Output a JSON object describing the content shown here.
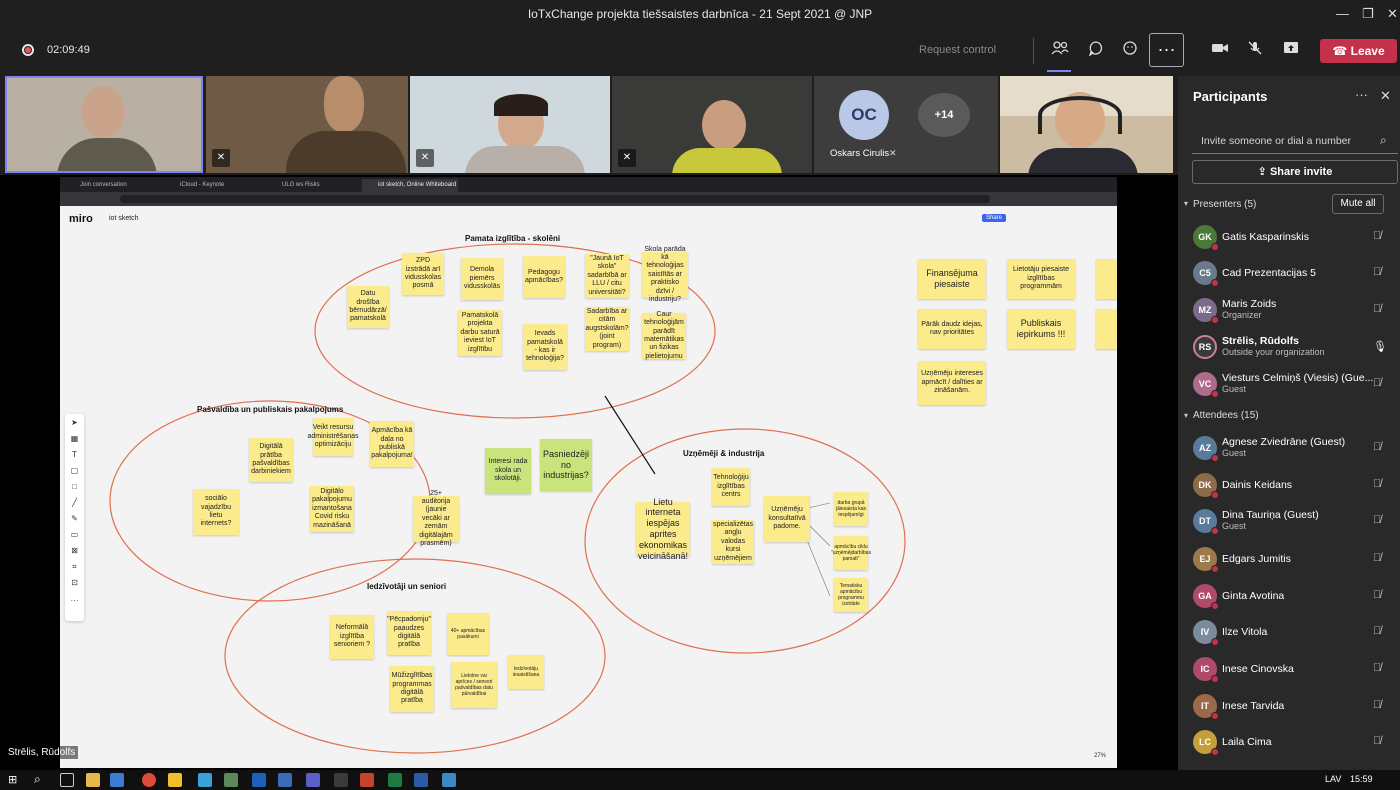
{
  "window": {
    "title": "IoTxChange projekta tiešsaistes darbnīca - 21 Sept 2021 @ JNP"
  },
  "toolbar": {
    "timer": "02:09:49",
    "request_control": "Request control",
    "leave_label": "Leave"
  },
  "videos": {
    "initials": "OC",
    "name": "Oskars Cirulis",
    "overflow": "+14",
    "speaker_label": "Strēlis, Rūdolfs"
  },
  "browser": {
    "tabs": [
      "Join conversation",
      "iCloud - Keynote",
      "ULG ws Risks",
      "iot sketch, Online Whiteboard f..."
    ],
    "app_name": "miro",
    "board_name": "iot sketch",
    "share_label": "Share",
    "zoom": "27%"
  },
  "board": {
    "frames": {
      "school": "Pamata izglītība - skolēni",
      "municipal": "Pašvaldība un publiskais pakalpojums",
      "business": "Uzņēmēji & industrija",
      "seniors": "Iedzīvotāji un seniori"
    },
    "stickies": {
      "s1": "Datu drošība bērnudārzā/ pamatskolā",
      "s2": "ZPD izstrādā arī vidusskolas posmā",
      "s3": "Demola piemērs vidusskolās",
      "s4": "Pamatskolā projekta darbu saturā ieviest IoT izglītību",
      "s5": "Pedagogu apmācības?",
      "s6": "Ievads pamatskolā - kas ir tehnoloģija?",
      "s7": "\"Jaunā IoT skola\" sadarbībā ar LLU / citu universitāti?",
      "s8": "Sadarbība ar citām augstskolām? (joint program)",
      "s9": "Skola parāda kā tehnoloģijas saistītās ar praktisko dzīvi / industriju?",
      "s10": "Caur tehnoloģijām parādīt matemātikas un fizikas pielietojumu",
      "m1": "Digitālā prātība pašvaldības darbiniekiem",
      "m2": "Veikt resursu administrēšanas optimizāciju",
      "m3": "Apmācība kā daļa no publiskā pakalpojuma!",
      "m4": "sociālo vajadzību lietu internets?",
      "m5": "Digitālo pakalpojumu izmantošana Covid risku mazināšanā",
      "m6": "25+ auditorija (jaunie vecāki ar zemām digitālajām prasmēm)",
      "g1": "Interesi rada skola un skolotāji.",
      "g2": "Pasniedzēji no industrijas?",
      "b1": "Lietu interneta iespējas aprites ekonomikas veicināšanā!",
      "b2": "Tehnoloģiju izglītības centrs",
      "b3": "specializētas angļu valodas kursi uzņēmējiem",
      "b4": "Uzņēmēju konsultatīvā padome.",
      "b5": "darba grupā jāiesaista kas iespējamīgi",
      "b6": "apmācību ciklu \"uzņēmējdarbības pamati\"",
      "b7": "Tematisku apmācību programmu izstrāde",
      "r1": "Neformālā izglītība senioriem ?",
      "r2": "\"Pēcpadomju\" paaudzes digitālā pratība",
      "r3": "40+ apmācības pasākumi",
      "r4": "Mūžizglītības programmas digitālā pratība",
      "r5": "Lietotne vai aprīces / sensori pašvaldības datu pārvaldībai",
      "r6": "Iedzīvotāju iesaistīšana",
      "f1": "Finansējuma piesaiste",
      "f2": "Lietotāju piesaiste izglītības programmām",
      "f3": "Pārāk daudz idejas, nav prioritātes",
      "f4": "Publiskais iepirkums !!!",
      "f5": "Uzņēmēju intereses apmācīt / dalīties ar zināšanām."
    }
  },
  "panel": {
    "title": "Participants",
    "invite_placeholder": "Invite someone or dial a number",
    "share_invite": "Share invite",
    "presenters_header": "Presenters (5)",
    "mute_all": "Mute all",
    "attendees_header": "Attendees (15)",
    "presenters": [
      {
        "initials": "GK",
        "name": "Gatis Kasparinskis",
        "sub": "",
        "color": "#4a7a3a"
      },
      {
        "initials": "C5",
        "name": "Cad Prezentacijas 5",
        "sub": "",
        "color": "#6a7a8c"
      },
      {
        "initials": "MZ",
        "name": "Maris Zoids",
        "sub": "Organizer",
        "color": "#7a6a8c"
      },
      {
        "initials": "RS",
        "name": "Strēlis, Rūdolfs",
        "sub": "Outside your organization",
        "color": "#3a3a3a"
      },
      {
        "initials": "VC",
        "name": "Viesturs Celmiņš (Viesis) (Gue...",
        "sub": "Guest",
        "color": "#b06a8c"
      }
    ],
    "attendees": [
      {
        "initials": "AZ",
        "name": "Agnese Zviedrāne (Guest)",
        "sub": "Guest",
        "color": "#5a7a9c"
      },
      {
        "initials": "DK",
        "name": "Dainis Keidans",
        "sub": "",
        "color": "#8c6a4a"
      },
      {
        "initials": "DT",
        "name": "Dina Tauriņa (Guest)",
        "sub": "Guest",
        "color": "#5a7a9c"
      },
      {
        "initials": "EJ",
        "name": "Edgars Jumitis",
        "sub": "",
        "color": "#9c7a4a"
      },
      {
        "initials": "GA",
        "name": "Ginta Avotina",
        "sub": "",
        "color": "#b04a6a"
      },
      {
        "initials": "IV",
        "name": "Ilze Vitola",
        "sub": "",
        "color": "#7a8c9c"
      },
      {
        "initials": "IC",
        "name": "Inese Cinovska",
        "sub": "",
        "color": "#b04a6a"
      },
      {
        "initials": "IT",
        "name": "Inese Tarvida",
        "sub": "",
        "color": "#9c6a4a"
      },
      {
        "initials": "LC",
        "name": "Laila Cima",
        "sub": "",
        "color": "#c4a03a"
      }
    ]
  },
  "taskbar": {
    "lang": "LAV",
    "clock": "15:59"
  }
}
